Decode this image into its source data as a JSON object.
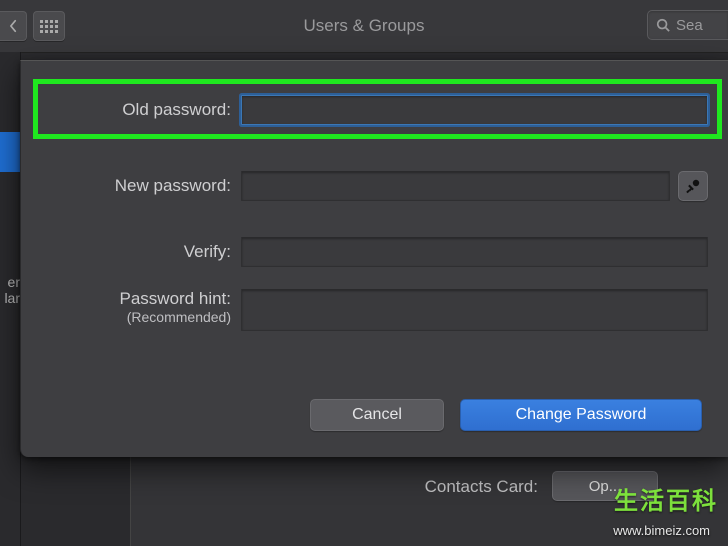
{
  "window": {
    "title": "Users & Groups",
    "search_placeholder": "Sea"
  },
  "dialog": {
    "fields": {
      "old_password": {
        "label": "Old password:",
        "value": ""
      },
      "new_password": {
        "label": "New password:",
        "value": ""
      },
      "verify": {
        "label": "Verify:",
        "value": ""
      },
      "hint": {
        "label": "Password hint:",
        "sub": "(Recommended)",
        "value": ""
      }
    },
    "buttons": {
      "cancel": "Cancel",
      "change": "Change Password"
    }
  },
  "content": {
    "contacts_card_label": "Contacts Card:",
    "open_label": "Op..."
  },
  "watermark": {
    "logo": "生活百科",
    "url": "www.bimeiz.com"
  }
}
